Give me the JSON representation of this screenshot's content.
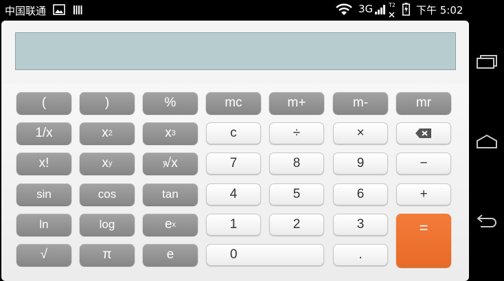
{
  "status": {
    "carrier": "中国联通",
    "network": "3G",
    "sim_label": "T2",
    "time": "下午 5:02"
  },
  "display": {
    "value": ""
  },
  "keys": {
    "lparen": "(",
    "rparen": ")",
    "percent": "%",
    "mc": "mc",
    "mplus": "m+",
    "mminus": "m-",
    "mr": "mr",
    "reciprocal": "1/x",
    "square_base": "x",
    "square_exp": "2",
    "cube_base": "x",
    "cube_exp": "3",
    "clear": "c",
    "divide": "÷",
    "multiply": "×",
    "factorial": "x!",
    "power_base": "x",
    "power_exp": "y",
    "root_index": "y",
    "root_sign": "√",
    "root_base": "x",
    "seven": "7",
    "eight": "8",
    "nine": "9",
    "minus": "−",
    "sin": "sin",
    "cos": "cos",
    "tan": "tan",
    "four": "4",
    "five": "5",
    "six": "6",
    "plus": "+",
    "ln": "ln",
    "log": "log",
    "exp_base": "e",
    "exp_exp": "x",
    "one": "1",
    "two": "2",
    "three": "3",
    "equals": "=",
    "sqrt": "√",
    "pi": "π",
    "e": "e",
    "zero": "0",
    "dot": "."
  },
  "colors": {
    "accent": "#ef7531",
    "display_bg": "#b7cccf",
    "gray_key": "#959595"
  }
}
